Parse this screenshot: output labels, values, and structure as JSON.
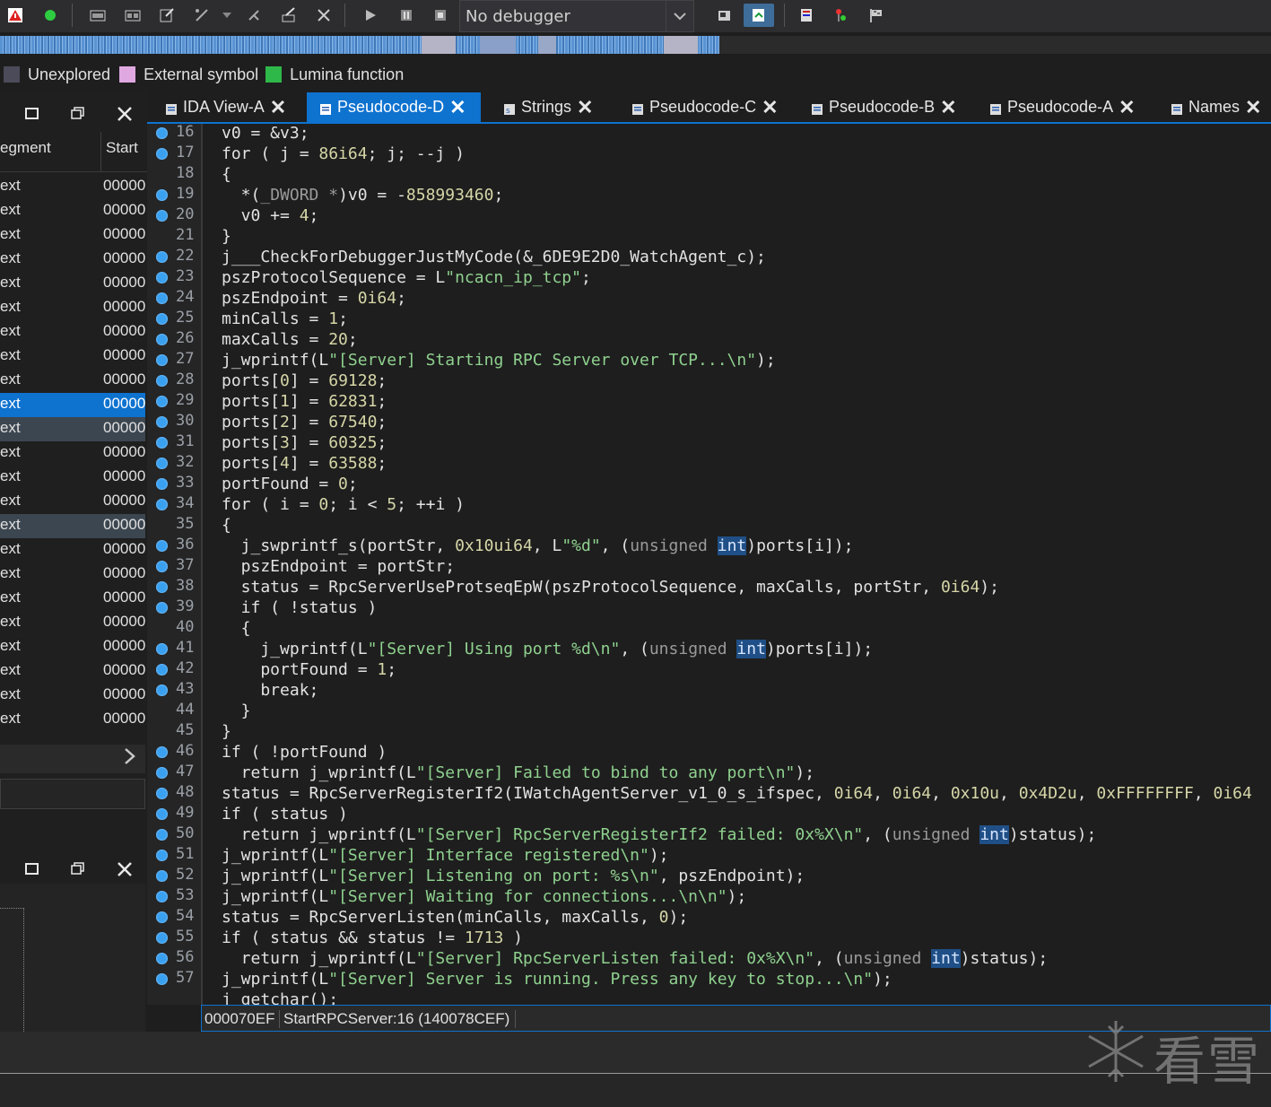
{
  "toolbar": {
    "debugger_label": "No debugger"
  },
  "legend": [
    {
      "label": "Unexplored",
      "color": "#4b4b5a"
    },
    {
      "label": "External symbol",
      "color": "#e0a8e0"
    },
    {
      "label": "Lumina function",
      "color": "#2fb84a"
    }
  ],
  "segments": {
    "header": {
      "segment": "egment",
      "start": "Start"
    },
    "rows": [
      {
        "segment": "ext",
        "start": "00000"
      },
      {
        "segment": "ext",
        "start": "00000"
      },
      {
        "segment": "ext",
        "start": "00000"
      },
      {
        "segment": "ext",
        "start": "00000"
      },
      {
        "segment": "ext",
        "start": "00000"
      },
      {
        "segment": "ext",
        "start": "00000"
      },
      {
        "segment": "ext",
        "start": "00000"
      },
      {
        "segment": "ext",
        "start": "00000"
      },
      {
        "segment": "ext",
        "start": "00000"
      },
      {
        "segment": "ext",
        "start": "00000"
      },
      {
        "segment": "ext",
        "start": "00000"
      },
      {
        "segment": "ext",
        "start": "00000"
      },
      {
        "segment": "ext",
        "start": "00000"
      },
      {
        "segment": "ext",
        "start": "00000"
      },
      {
        "segment": "ext",
        "start": "00000"
      },
      {
        "segment": "ext",
        "start": "00000"
      },
      {
        "segment": "ext",
        "start": "00000"
      },
      {
        "segment": "ext",
        "start": "00000"
      },
      {
        "segment": "ext",
        "start": "00000"
      },
      {
        "segment": "ext",
        "start": "00000"
      },
      {
        "segment": "ext",
        "start": "00000"
      },
      {
        "segment": "ext",
        "start": "00000"
      },
      {
        "segment": "ext",
        "start": "00000"
      }
    ]
  },
  "tabs": [
    {
      "label": "IDA View-A",
      "active": false
    },
    {
      "label": "Pseudocode-D",
      "active": true
    },
    {
      "label": "Strings",
      "active": false
    },
    {
      "label": "Pseudocode-C",
      "active": false
    },
    {
      "label": "Pseudocode-B",
      "active": false
    },
    {
      "label": "Pseudocode-A",
      "active": false
    },
    {
      "label": "Names",
      "active": false
    }
  ],
  "code": {
    "line_numbers": [
      "16",
      "17",
      "18",
      "19",
      "20",
      "21",
      "22",
      "23",
      "24",
      "25",
      "26",
      "27",
      "28",
      "29",
      "30",
      "31",
      "32",
      "33",
      "34",
      "35",
      "36",
      "37",
      "38",
      "39",
      "40",
      "41",
      "42",
      "43",
      "44",
      "45",
      "46",
      "47",
      "48",
      "49",
      "50",
      "51",
      "52",
      "53",
      "54",
      "55",
      "56",
      "57"
    ],
    "lines": [
      "v0 = &v3;",
      "for ( j = 86i64; j; --j )",
      "{",
      "  *(_DWORD *)v0 = -858993460;",
      "  v0 += 4;",
      "}",
      "j___CheckForDebuggerJustMyCode(&_6DE9E2D0_WatchAgent_c);",
      "pszProtocolSequence = L\"ncacn_ip_tcp\";",
      "pszEndpoint = 0i64;",
      "minCalls = 1;",
      "maxCalls = 20;",
      "j_wprintf(L\"[Server] Starting RPC Server over TCP...\\n\");",
      "ports[0] = 69128;",
      "ports[1] = 62831;",
      "ports[2] = 67540;",
      "ports[3] = 60325;",
      "ports[4] = 63588;",
      "portFound = 0;",
      "for ( i = 0; i < 5; ++i )",
      "{",
      "  j_swprintf_s(portStr, 0x10ui64, L\"%d\", (unsigned int)ports[i]);",
      "  pszEndpoint = portStr;",
      "  status = RpcServerUseProtseqEpW(pszProtocolSequence, maxCalls, portStr, 0i64);",
      "  if ( !status )",
      "  {",
      "    j_wprintf(L\"[Server] Using port %d\\n\", (unsigned int)ports[i]);",
      "    portFound = 1;",
      "    break;",
      "  }",
      "}",
      "if ( !portFound )",
      "  return j_wprintf(L\"[Server] Failed to bind to any port\\n\");",
      "status = RpcServerRegisterIf2(IWatchAgentServer_v1_0_s_ifspec, 0i64, 0i64, 0x10u, 0x4D2u, 0xFFFFFFFF, 0i64",
      "if ( status )",
      "  return j_wprintf(L\"[Server] RpcServerRegisterIf2 failed: 0x%X\\n\", (unsigned int)status);",
      "j_wprintf(L\"[Server] Interface registered\\n\");",
      "j_wprintf(L\"[Server] Listening on port: %s\\n\", pszEndpoint);",
      "j_wprintf(L\"[Server] Waiting for connections...\\n\\n\");",
      "status = RpcServerListen(minCalls, maxCalls, 0);",
      "if ( status && status != 1713 )",
      "  return j_wprintf(L\"[Server] RpcServerListen failed: 0x%X\\n\", (unsigned int)status);",
      "j_wprintf(L\"[Server] Server is running. Press any key to stop...\\n\");",
      "j_getchar();"
    ]
  },
  "statusbar": {
    "address": "000070EF",
    "location": "StartRPCServer:16 (140078CEF)"
  },
  "watermark": {
    "text": "看雪"
  }
}
